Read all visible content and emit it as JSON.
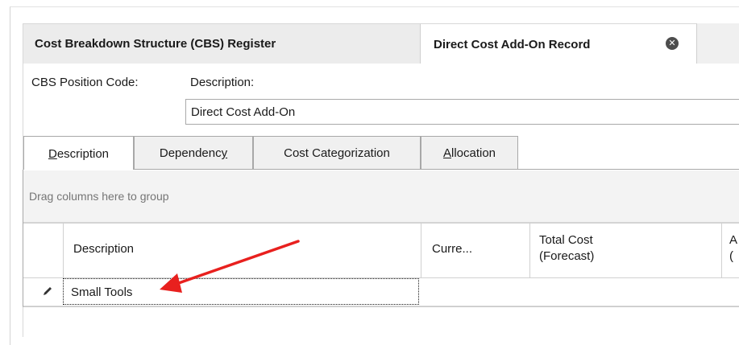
{
  "doc_tabs": [
    {
      "label": "Cost Breakdown Structure (CBS) Register"
    },
    {
      "label": "Direct Cost Add-On Record"
    }
  ],
  "close_icon_glyph": "✕",
  "fields": {
    "cbs_position_code_label": "CBS Position Code:",
    "description_label": "Description:",
    "description_value": "Direct Cost Add-On"
  },
  "page_tabs": [
    {
      "key": "D",
      "rest": "escription",
      "label": "Description",
      "active": true
    },
    {
      "pre": "Dependenc",
      "key": "y",
      "label": "Dependency"
    },
    {
      "label": "Cost Categorization"
    },
    {
      "key": "A",
      "rest": "llocation",
      "label": "Allocation"
    }
  ],
  "grid": {
    "group_panel_text": "Drag columns here to group",
    "columns": [
      {
        "label": "Description"
      },
      {
        "label": "Curre..."
      },
      {
        "label": "Total Cost (Forecast)",
        "line1": "Total Cost",
        "line2": "(Forecast)"
      },
      {
        "label": "A",
        "line1": "A",
        "line2": "("
      }
    ],
    "rows": [
      {
        "description": "Small Tools",
        "editing": true
      }
    ]
  },
  "annotation": {
    "arrow_color": "#e8201e"
  },
  "colors": {
    "active_tab_bg": "#ffffff",
    "tab_bg": "#f0f0f0",
    "group_panel_bg": "#f3f3f3"
  }
}
